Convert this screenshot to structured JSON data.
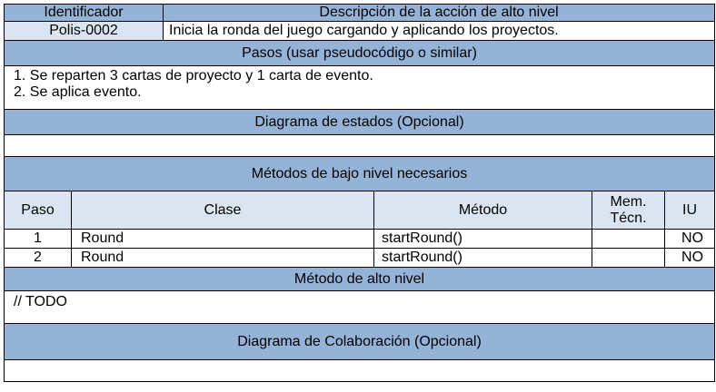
{
  "header": {
    "id_label": "Identificador",
    "desc_label": "Descripción de la acción de alto nivel"
  },
  "identifier": "Polis-0002",
  "description": "Inicia la ronda del juego cargando y aplicando los proyectos.",
  "steps": {
    "title": "Pasos (usar pseudocódigo o similar)",
    "lines": [
      "1. Se reparten 3 cartas de proyecto y 1 carta de evento.",
      "2. Se aplica evento."
    ]
  },
  "state_diagram": {
    "title": "Diagrama de estados (Opcional)"
  },
  "low_level": {
    "title": "Métodos de bajo nivel necesarios",
    "columns": {
      "paso": "Paso",
      "clase": "Clase",
      "metodo": "Método",
      "mem_line1": "Mem.",
      "mem_line2": "Técn.",
      "iu": "IU"
    },
    "rows": [
      {
        "paso": "1",
        "clase": "Round",
        "metodo": "startRound()",
        "mem": "",
        "iu": "NO"
      },
      {
        "paso": "2",
        "clase": "Round",
        "metodo": "startRound()",
        "mem": "",
        "iu": "NO"
      }
    ]
  },
  "high_level": {
    "title": "Método de alto nivel",
    "body": "// TODO"
  },
  "collab_diagram": {
    "title": "Diagrama de Colaboración (Opcional)"
  },
  "colors": {
    "header_bg": "#95b3d7",
    "light_bg": "#dbe5f1"
  }
}
